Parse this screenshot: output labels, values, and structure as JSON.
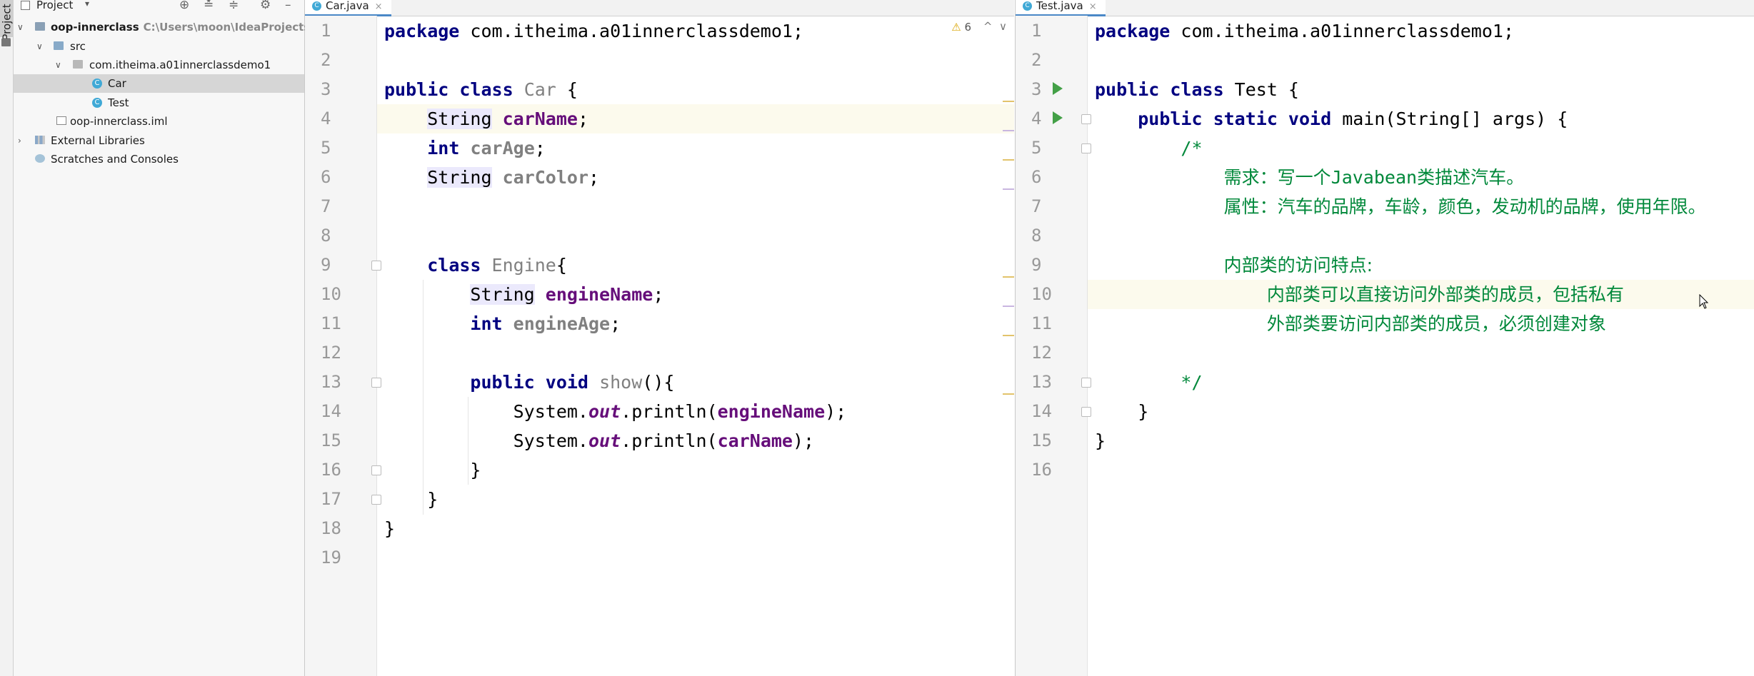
{
  "sidebar": {
    "stripe_label": "Project"
  },
  "project_panel": {
    "title": "Project",
    "dropdown": "▾",
    "toolbar_icons": [
      "⊕",
      "≛",
      "≑",
      "⚙",
      "–"
    ],
    "tree": [
      {
        "label": "oop-innerclass",
        "path": "C:\\Users\\moon\\IdeaProjects\\",
        "icon": "module-icon",
        "arrow": "∨",
        "bold": true
      },
      {
        "label": "src",
        "icon": "folder-icon",
        "arrow": "∨"
      },
      {
        "label": "com.itheima.a01innerclassdemo1",
        "icon": "package-icon",
        "arrow": "∨"
      },
      {
        "label": "Car",
        "icon": "class-icon",
        "selected": true
      },
      {
        "label": "Test",
        "icon": "class-icon"
      },
      {
        "label": "oop-innerclass.iml",
        "icon": "file-icon"
      },
      {
        "label": "External Libraries",
        "icon": "library-icon",
        "arrow": "›"
      },
      {
        "label": "Scratches and Consoles",
        "icon": "scratch-icon"
      }
    ]
  },
  "editor_left": {
    "tab": {
      "label": "Car.java",
      "icon": "C",
      "close": "×"
    },
    "warnings": {
      "icon": "⚠",
      "count": "6",
      "up": "^",
      "down": "∨"
    },
    "lines": [
      "1",
      "2",
      "3",
      "4",
      "5",
      "6",
      "7",
      "8",
      "9",
      "10",
      "11",
      "12",
      "13",
      "14",
      "15",
      "16",
      "17",
      "18",
      "19"
    ],
    "code": {
      "l1_kw": "package",
      "l1_rest": " com.itheima.a01innerclassdemo1;",
      "l3_kw": "public class",
      "l3_name": "Car",
      "l3_brace": " {",
      "l4_type": "String",
      "l4_name": "carName",
      "l4_end": ";",
      "l5_kw": "int",
      "l5_name": "carAge",
      "l5_end": ";",
      "l6_type": "String",
      "l6_name": "carColor",
      "l6_end": ";",
      "l9_kw": "class",
      "l9_name": "Engine",
      "l9_brace": "{",
      "l10_type": "String",
      "l10_name": "engineName",
      "l10_end": ";",
      "l11_kw": "int",
      "l11_name": "engineAge",
      "l11_end": ";",
      "l13_kw": "public void",
      "l13_name": "show",
      "l13_end": "(){",
      "l14_a": "System.",
      "l14_out": "out",
      "l14_b": ".println(",
      "l14_arg": "engineName",
      "l14_end": ");",
      "l15_a": "System.",
      "l15_out": "out",
      "l15_b": ".println(",
      "l15_arg": "carName",
      "l15_end": ");",
      "l16": "}",
      "l17": "}",
      "l18": "}"
    }
  },
  "editor_right": {
    "tab": {
      "label": "Test.java",
      "icon": "C",
      "close": "×"
    },
    "lines": [
      "1",
      "2",
      "3",
      "4",
      "5",
      "6",
      "7",
      "8",
      "9",
      "10",
      "11",
      "12",
      "13",
      "14",
      "15",
      "16"
    ],
    "code": {
      "l1_kw": "package",
      "l1_rest": " com.itheima.a01innerclassdemo1;",
      "l3_kw": "public class",
      "l3_rest": " Test {",
      "l4_kw": "public static void",
      "l4_rest": " main(String[] args) {",
      "l5": "/*",
      "l6_a": "需求：写一个",
      "l6_b": "Javabean",
      "l6_c": "类描述汽车。",
      "l7": "属性：汽车的品牌，车龄，颜色，发动机的品牌，使用年限。",
      "l9": "内部类的访问特点:",
      "l10": "内部类可以直接访问外部类的成员，包括私有",
      "l11": "外部类要访问内部类的成员，必须创建对象",
      "l13": "*/",
      "l14": "}",
      "l15": "}"
    }
  },
  "colors": {
    "keyword": "#000080",
    "field": "#660e7a",
    "comment": "#00883a",
    "current_line": "#fcfaed",
    "tab_underline": "#4a88c7",
    "run_icon": "#43a047"
  }
}
